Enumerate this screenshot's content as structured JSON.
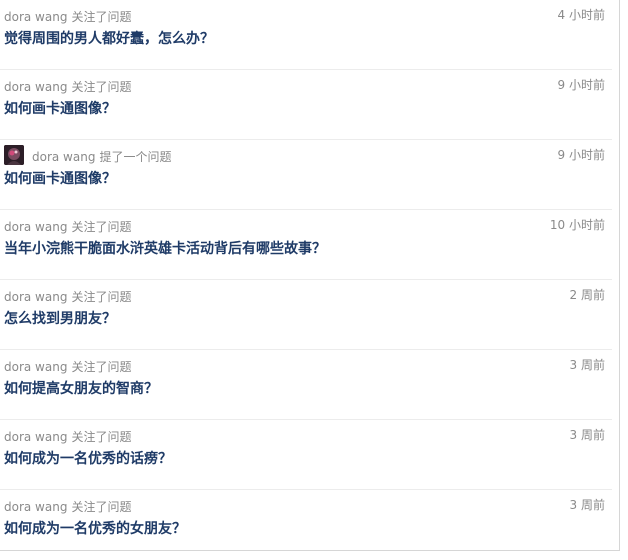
{
  "feed": {
    "items": [
      {
        "user": "dora wang",
        "action": "关注了问题",
        "time": "4 小时前",
        "title": "觉得周围的男人都好蠢，怎么办？"
      },
      {
        "user": "dora wang",
        "action": "关注了问题",
        "time": "9 小时前",
        "title": "如何画卡通图像？"
      },
      {
        "user": "dora wang",
        "action": "提了一个问题",
        "time": "9 小时前",
        "title": "如何画卡通图像？",
        "has_avatar": true
      },
      {
        "user": "dora wang",
        "action": "关注了问题",
        "time": "10 小时前",
        "title": "当年小浣熊干脆面水浒英雄卡活动背后有哪些故事？"
      },
      {
        "user": "dora wang",
        "action": "关注了问题",
        "time": "2 周前",
        "title": "怎么找到男朋友？"
      },
      {
        "user": "dora wang",
        "action": "关注了问题",
        "time": "3 周前",
        "title": "如何提高女朋友的智商？"
      },
      {
        "user": "dora wang",
        "action": "关注了问题",
        "time": "3 周前",
        "title": "如何成为一名优秀的话痨？"
      },
      {
        "user": "dora wang",
        "action": "关注了问题",
        "time": "3 周前",
        "title": "如何成为一名优秀的女朋友？"
      }
    ]
  },
  "colors": {
    "title": "#1f3b67",
    "meta": "#8a8a8a",
    "divider": "#ececec"
  },
  "icons": {
    "avatar": "user-avatar-icon"
  }
}
